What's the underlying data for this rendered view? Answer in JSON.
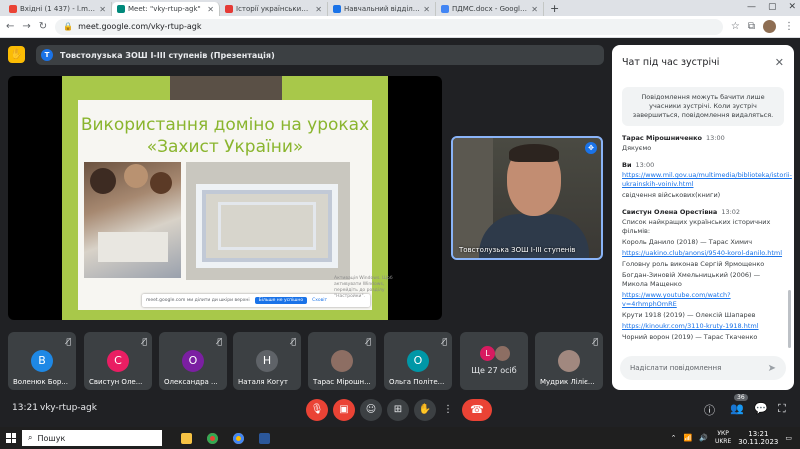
{
  "browser": {
    "tabs": [
      {
        "label": "Вхідні (1 437) - l.mudryk@ippo...",
        "color": "#ea4335",
        "active": false
      },
      {
        "label": "Meet: \"vky-rtup-agk\"",
        "color": "#00897b",
        "active": true
      },
      {
        "label": "Історії українських воїнів | Мі...",
        "color": "#e53935",
        "active": false
      },
      {
        "label": "Навчальний відділ ТОКІППО ...",
        "color": "#1a73e8",
        "active": false
      },
      {
        "label": "ПДМС.docx - Google Докумен...",
        "color": "#4285f4",
        "active": false
      }
    ],
    "new_tab": "+",
    "url": "meet.google.com/vky-rtup-agk"
  },
  "meet": {
    "presenter_initial": "Т",
    "presenter_title": "Товстолузька ЗОШ I-III ступенів (Презентація)",
    "slide": {
      "title": "Використання доміно на уроках «Захист України»",
      "notice_text": "meet.google.com ми ділити ди шкіри верхні",
      "notice_primary": "Більше не успішно",
      "notice_secondary": "Сховіт",
      "watermark": "Активація Windows. Щоб активувати Windows, перейдіть до розділу \"Настройки\"."
    },
    "speaker": {
      "name": "Товстолузька ЗОШ І-ІІІ ступенів"
    },
    "participants": [
      {
        "initial": "В",
        "name": "Воленюк Бор...",
        "color": "#1e88e5"
      },
      {
        "initial": "С",
        "name": "Свистун Оле...",
        "color": "#e91e63"
      },
      {
        "initial": "О",
        "name": "Олександра ...",
        "color": "#7b1fa2"
      },
      {
        "initial": "Н",
        "name": "Наталя Когут",
        "color": "#5f6368"
      },
      {
        "initial": "",
        "name": "Тарас Мірошн...",
        "color": "#8d6e63"
      },
      {
        "initial": "О",
        "name": "Ольга Політе...",
        "color": "#0097a7"
      },
      {
        "initial": "L",
        "name": "",
        "color": "#d81b60",
        "more_label": "Ще 27 осіб"
      },
      {
        "initial": "",
        "name": "Мудрик Ліліє...",
        "color": "#a1887f"
      }
    ]
  },
  "chat": {
    "title": "Чат під час зустрічі",
    "info": "Повідомлення можуть бачити лише учасники зустрічі. Коли зустріч завершиться, повідомлення видаляться.",
    "messages": [
      {
        "author": "Тарас Мірошниченко",
        "time": "13:00",
        "lines": [
          {
            "text": "Дякуємо",
            "link": false
          }
        ]
      },
      {
        "author": "Ви",
        "time": "13:00",
        "lines": [
          {
            "text": "https://www.mil.gov.ua/multimedia/biblioteka/istorii-ukrainskih-voiniv.html",
            "link": true
          },
          {
            "text": "свідчення військових(книги)",
            "link": false
          }
        ]
      },
      {
        "author": "Свистун Олена Орестівна",
        "time": "13:02",
        "lines": [
          {
            "text": "Список найкращих українських історичних фільмів:",
            "link": false
          },
          {
            "text": "Король Данило (2018) — Тарас Химич",
            "link": false
          },
          {
            "text": "https://uakino.club/anonsi/9540-korol-danilo.html",
            "link": true
          },
          {
            "text": "Головну роль виконав Сергій Ярмощенко",
            "link": false
          },
          {
            "text": "Богдан-Зиновій Хмельницький (2006) — Микола Мащенко",
            "link": false
          },
          {
            "text": "https://www.youtube.com/watch?v=4rhmphOmRE",
            "link": true
          },
          {
            "text": "Крути 1918 (2019) — Олексій Шапарев",
            "link": false
          },
          {
            "text": "https://kinoukr.com/3110-kruty-1918.html",
            "link": true
          },
          {
            "text": "Чорний ворон (2019) — Тарас Ткаченко",
            "link": false
          }
        ]
      }
    ],
    "input_placeholder": "Надіслати повідомлення"
  },
  "controls": {
    "time": "13:21",
    "meeting_code": "vky-rtup-agk",
    "participants_badge": "36"
  },
  "taskbar": {
    "search_label": "Пошук",
    "lang_top": "УКР",
    "lang_bottom": "UKRE",
    "clock_time": "13:21",
    "clock_date": "30.11.2023"
  }
}
